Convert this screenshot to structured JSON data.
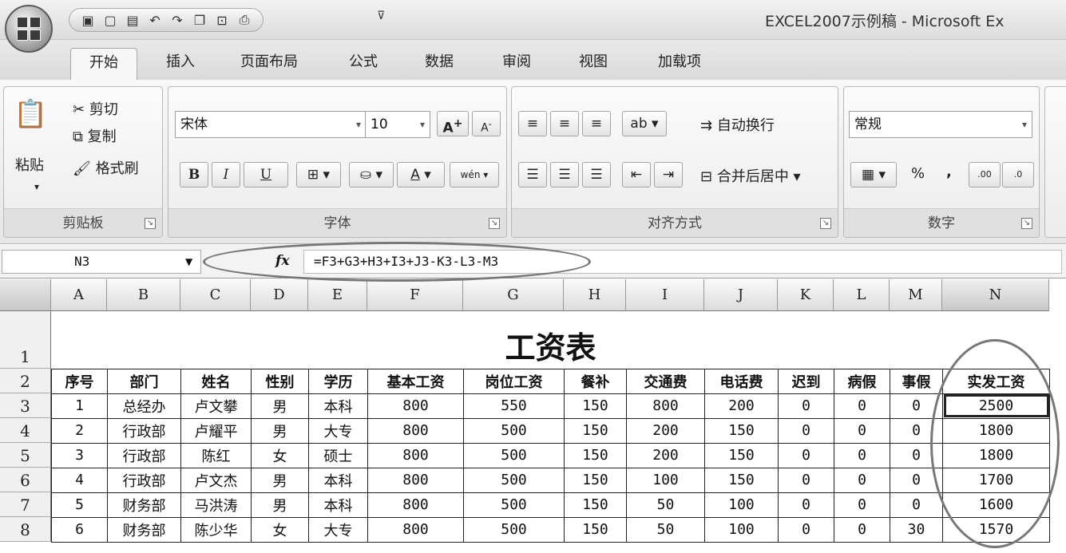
{
  "window": {
    "title": "EXCEL2007示例稿 - Microsoft Ex"
  },
  "tabs": [
    "开始",
    "插入",
    "页面布局",
    "公式",
    "数据",
    "审阅",
    "视图",
    "加载项"
  ],
  "clipboard": {
    "paste": "粘贴",
    "cut": "剪切",
    "copy": "复制",
    "format_painter": "格式刷",
    "label": "剪贴板"
  },
  "font": {
    "name": "宋体",
    "size": "10",
    "label": "字体",
    "bold": "B",
    "italic": "I",
    "underline": "U",
    "grow": "A",
    "shrink": "A",
    "phonetic": "wén"
  },
  "alignment": {
    "wrap": "自动换行",
    "merge": "合并后居中",
    "label": "对齐方式"
  },
  "number": {
    "format": "常规",
    "percent": "%",
    "comma": ",",
    "inc_decimal": ".00",
    "dec_decimal": ".0",
    "label": "数字"
  },
  "formula_bar": {
    "cell_ref": "N3",
    "fx": "fx",
    "formula": "=F3+G3+H3+I3+J3-K3-L3-M3"
  },
  "columns": [
    "A",
    "B",
    "C",
    "D",
    "E",
    "F",
    "G",
    "H",
    "I",
    "J",
    "K",
    "L",
    "M",
    "N"
  ],
  "row_numbers": [
    "1",
    "2",
    "3",
    "4",
    "5",
    "6",
    "7",
    "8"
  ],
  "sheet": {
    "title": "工资表",
    "headers": [
      "序号",
      "部门",
      "姓名",
      "性别",
      "学历",
      "基本工资",
      "岗位工资",
      "餐补",
      "交通费",
      "电话费",
      "迟到",
      "病假",
      "事假",
      "实发工资"
    ],
    "rows": [
      [
        "1",
        "总经办",
        "卢文攀",
        "男",
        "本科",
        "800",
        "550",
        "150",
        "800",
        "200",
        "0",
        "0",
        "0",
        "2500"
      ],
      [
        "2",
        "行政部",
        "卢耀平",
        "男",
        "大专",
        "800",
        "500",
        "150",
        "200",
        "150",
        "0",
        "0",
        "0",
        "1800"
      ],
      [
        "3",
        "行政部",
        "陈红",
        "女",
        "硕士",
        "800",
        "500",
        "150",
        "200",
        "150",
        "0",
        "0",
        "0",
        "1800"
      ],
      [
        "4",
        "行政部",
        "卢文杰",
        "男",
        "本科",
        "800",
        "500",
        "150",
        "100",
        "150",
        "0",
        "0",
        "0",
        "1700"
      ],
      [
        "5",
        "财务部",
        "马洪涛",
        "男",
        "本科",
        "800",
        "500",
        "150",
        "50",
        "100",
        "0",
        "0",
        "0",
        "1600"
      ],
      [
        "6",
        "财务部",
        "陈少华",
        "女",
        "大专",
        "800",
        "500",
        "150",
        "50",
        "100",
        "0",
        "0",
        "30",
        "1570"
      ]
    ]
  }
}
